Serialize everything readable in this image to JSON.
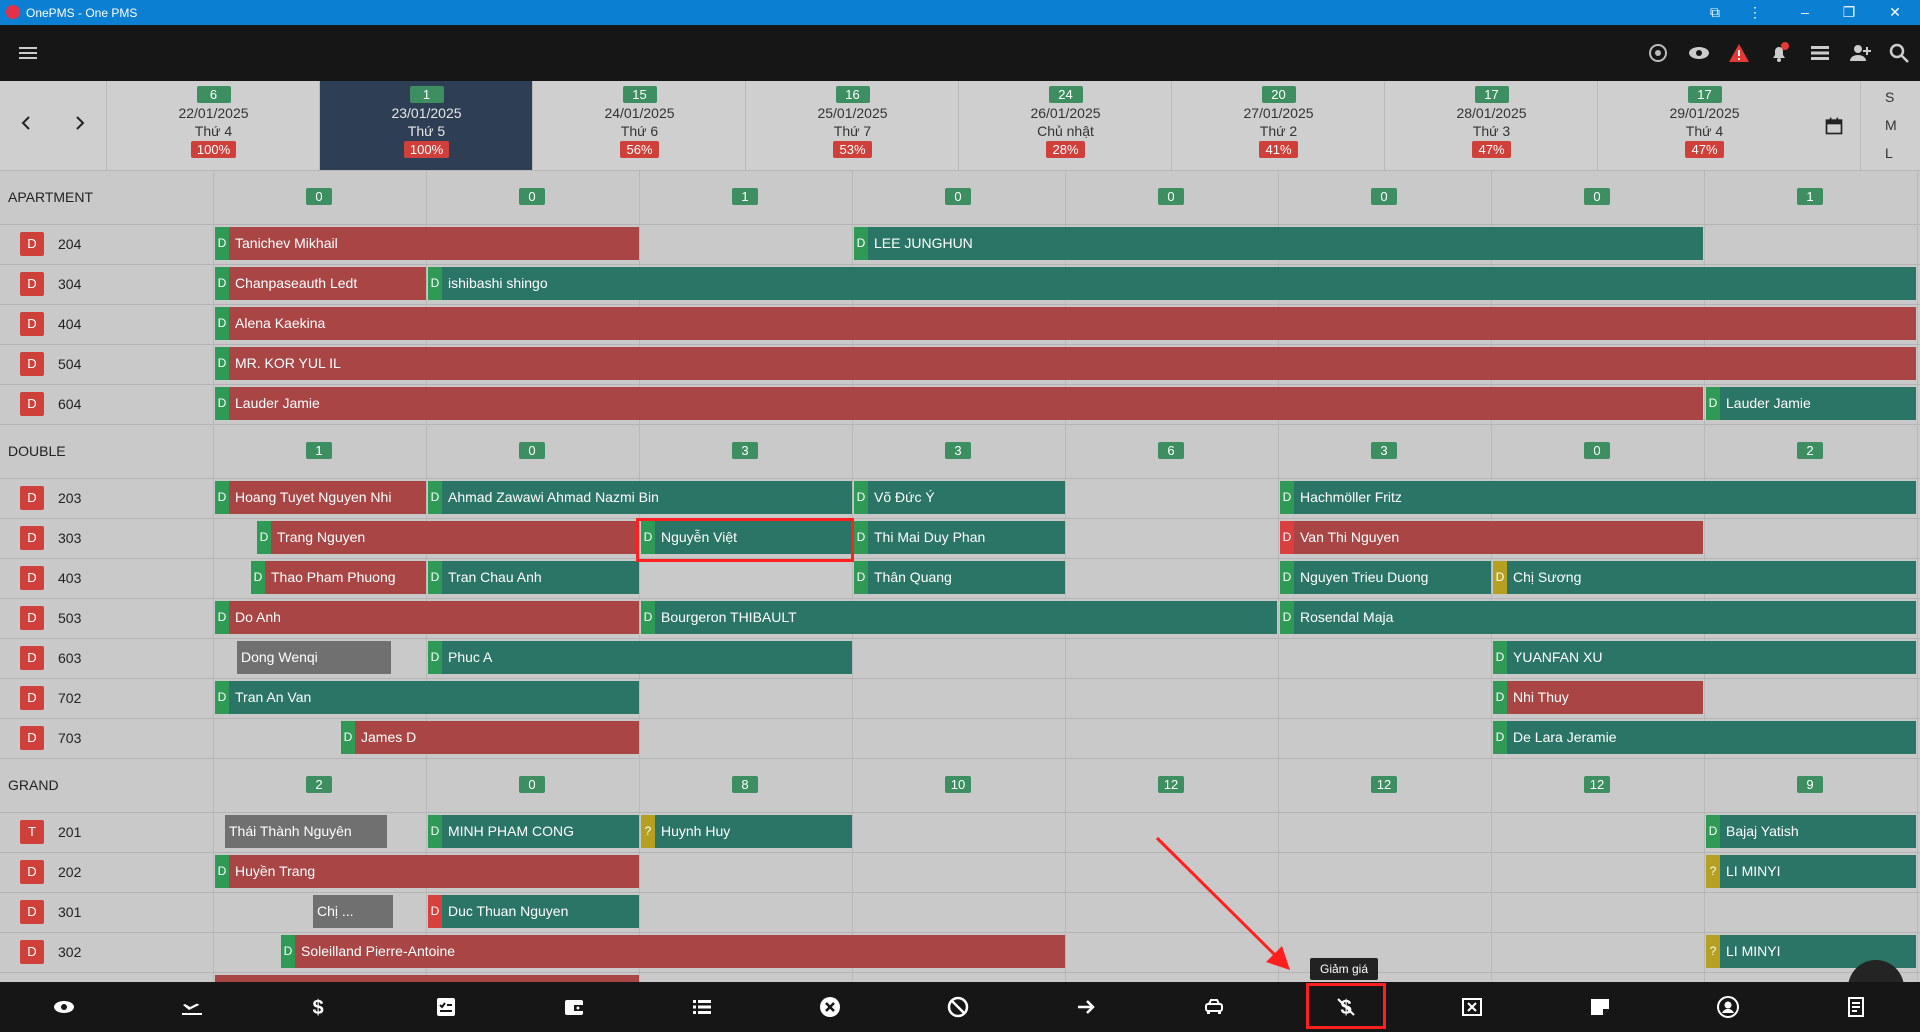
{
  "window": {
    "title": "OnePMS - One PMS"
  },
  "dates": [
    {
      "count": "6",
      "date": "22/01/2025",
      "weekday": "Thứ 4",
      "occupancy": "100%"
    },
    {
      "count": "1",
      "date": "23/01/2025",
      "weekday": "Thứ 5",
      "occupancy": "100%"
    },
    {
      "count": "15",
      "date": "24/01/2025",
      "weekday": "Thứ 6",
      "occupancy": "56%"
    },
    {
      "count": "16",
      "date": "25/01/2025",
      "weekday": "Thứ 7",
      "occupancy": "53%"
    },
    {
      "count": "24",
      "date": "26/01/2025",
      "weekday": "Chủ nhật",
      "occupancy": "28%"
    },
    {
      "count": "20",
      "date": "27/01/2025",
      "weekday": "Thứ 2",
      "occupancy": "41%"
    },
    {
      "count": "17",
      "date": "28/01/2025",
      "weekday": "Thứ 3",
      "occupancy": "47%"
    },
    {
      "count": "17",
      "date": "29/01/2025",
      "weekday": "Thứ 4",
      "occupancy": "47%"
    }
  ],
  "size_options": [
    "S",
    "M",
    "L"
  ],
  "groups": [
    {
      "name": "APARTMENT",
      "counts": [
        "0",
        "0",
        "1",
        "0",
        "0",
        "0",
        "0",
        "1"
      ]
    },
    {
      "name": "DOUBLE",
      "counts": [
        "1",
        "0",
        "3",
        "3",
        "6",
        "3",
        "0",
        "2"
      ]
    },
    {
      "name": "GRAND",
      "counts": [
        "2",
        "0",
        "8",
        "10",
        "12",
        "12",
        "12",
        "9"
      ]
    }
  ],
  "rooms": [
    {
      "badge": "D",
      "number": "204"
    },
    {
      "badge": "D",
      "number": "304"
    },
    {
      "badge": "D",
      "number": "404"
    },
    {
      "badge": "D",
      "number": "504"
    },
    {
      "badge": "D",
      "number": "604"
    },
    {
      "badge": "D",
      "number": "203"
    },
    {
      "badge": "D",
      "number": "303"
    },
    {
      "badge": "D",
      "number": "403"
    },
    {
      "badge": "D",
      "number": "503"
    },
    {
      "badge": "D",
      "number": "603"
    },
    {
      "badge": "D",
      "number": "702"
    },
    {
      "badge": "D",
      "number": "703"
    },
    {
      "badge": "T",
      "number": "201"
    },
    {
      "badge": "D",
      "number": "202"
    },
    {
      "badge": "D",
      "number": "301"
    },
    {
      "badge": "D",
      "number": "302"
    }
  ],
  "bookings": [
    {
      "tag": "D",
      "name": "Tanichev Mikhail"
    },
    {
      "tag": "D",
      "name": "LEE JUNGHUN"
    },
    {
      "tag": "D",
      "name": "Chanpaseauth Ledt"
    },
    {
      "tag": "D",
      "name": "ishibashi shingo"
    },
    {
      "tag": "D",
      "name": "Alena Kaekina"
    },
    {
      "tag": "D",
      "name": "MR. KOR YUL IL"
    },
    {
      "tag": "D",
      "name": "Lauder Jamie"
    },
    {
      "tag": "D",
      "name": "Lauder Jamie"
    },
    {
      "tag": "D",
      "name": "Hoang Tuyet Nguyen Nhi"
    },
    {
      "tag": "D",
      "name": "Ahmad Zawawi Ahmad Nazmi Bin"
    },
    {
      "tag": "D",
      "name": "Võ Đức Ý"
    },
    {
      "tag": "D",
      "name": "Hachmöller Fritz"
    },
    {
      "tag": "D",
      "name": "Trang Nguyen"
    },
    {
      "tag": "D",
      "name": "Nguyễn Việt"
    },
    {
      "tag": "D",
      "name": "Thi Mai Duy Phan"
    },
    {
      "tag": "D",
      "name": "Van Thi Nguyen"
    },
    {
      "tag": "D",
      "name": "Thao Pham Phuong"
    },
    {
      "tag": "D",
      "name": "Tran Chau Anh"
    },
    {
      "tag": "D",
      "name": "Thân Quang"
    },
    {
      "tag": "D",
      "name": "Nguyen Trieu Duong"
    },
    {
      "tag": "D",
      "name": "Chị Sương"
    },
    {
      "tag": "D",
      "name": "Do Anh"
    },
    {
      "tag": "D",
      "name": "Bourgeron THIBAULT"
    },
    {
      "tag": "D",
      "name": "Rosendal Maja"
    },
    {
      "tag": "",
      "name": "Dong Wenqi"
    },
    {
      "tag": "D",
      "name": "Phuc A"
    },
    {
      "tag": "D",
      "name": "YUANFAN XU"
    },
    {
      "tag": "D",
      "name": "Tran An Van"
    },
    {
      "tag": "D",
      "name": "Nhi Thuy"
    },
    {
      "tag": "D",
      "name": "James D"
    },
    {
      "tag": "D",
      "name": "De Lara Jeramie"
    },
    {
      "tag": "",
      "name": "Thái Thành Nguyên"
    },
    {
      "tag": "D",
      "name": "MINH PHAM CONG"
    },
    {
      "tag": "?",
      "name": "Huynh Huy"
    },
    {
      "tag": "D",
      "name": "Bajaj Yatish"
    },
    {
      "tag": "D",
      "name": "Huyền Trang"
    },
    {
      "tag": "?",
      "name": "LI MINYI"
    },
    {
      "tag": "",
      "name": "Chị ..."
    },
    {
      "tag": "D",
      "name": "Duc Thuan Nguyen"
    },
    {
      "tag": "D",
      "name": "Soleilland Pierre-Antoine"
    },
    {
      "tag": "?",
      "name": "LI MINYI"
    }
  ],
  "tooltip": {
    "text": "Giảm giá"
  },
  "colors": {
    "titlebar": "#0b7fd1",
    "booking_red": "#a94545",
    "booking_teal": "#2a7566",
    "count_green": "#3d8f61",
    "highlight": "#ff1f1f"
  }
}
